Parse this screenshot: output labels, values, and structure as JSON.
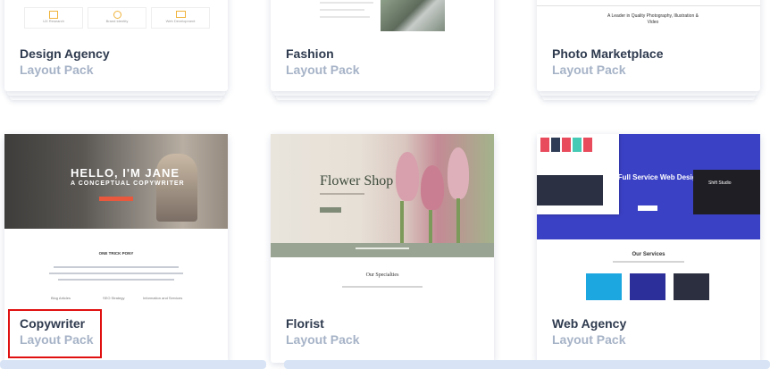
{
  "cards_top": [
    {
      "title": "Design Agency",
      "subtitle": "Layout Pack"
    },
    {
      "title": "Fashion",
      "subtitle": "Layout Pack"
    },
    {
      "title": "Photo Marketplace",
      "subtitle": "Layout Pack"
    }
  ],
  "cards_bottom": [
    {
      "title": "Copywriter",
      "subtitle": "Layout Pack"
    },
    {
      "title": "Florist",
      "subtitle": "Layout Pack"
    },
    {
      "title": "Web Agency",
      "subtitle": "Layout Pack"
    }
  ],
  "previews": {
    "photo_marketplace_tagline": "A Leader in Quality Photography, Illustration & Video",
    "copywriter": {
      "hero_line1": "HELLO, I'M JANE",
      "hero_line2": "A CONCEPTUAL COPYWRITER",
      "section": "ONE TRICK PONY",
      "services": [
        "Blog Articles",
        "SEO Strategy",
        "Information and Services"
      ]
    },
    "florist": {
      "hero": "Flower Shop",
      "section": "Our Specialties"
    },
    "web_agency": {
      "hero": "Full Service Web Design Agency",
      "brand": "Shift Studio",
      "section": "Our Services"
    },
    "design_agency_features": [
      "UX Research",
      "Brand Identity",
      "Web Development"
    ]
  }
}
